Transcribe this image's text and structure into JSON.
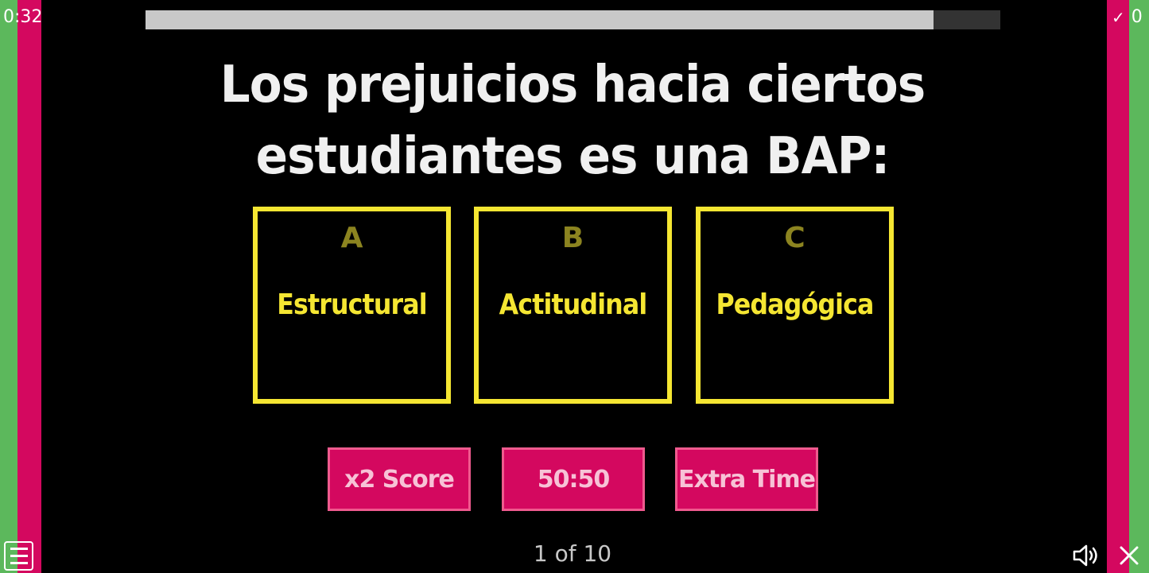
{
  "timer": "0:32",
  "score": {
    "icon": "check-icon",
    "value": "0"
  },
  "progress": {
    "fraction": 0.922
  },
  "question": "Los prejuicios hacia ciertos estudiantes es una BAP:",
  "answers": [
    {
      "letter": "A",
      "text": "Estructural"
    },
    {
      "letter": "B",
      "text": "Actitudinal"
    },
    {
      "letter": "C",
      "text": "Pedagógica"
    }
  ],
  "powerups": [
    {
      "label": "x2 Score"
    },
    {
      "label": "50:50"
    },
    {
      "label": "Extra Time"
    }
  ],
  "pager": "1 of 10",
  "icons": {
    "menu": "menu-icon",
    "sound": "speaker-icon",
    "close": "close-icon"
  },
  "colors": {
    "green": "#5cb85c",
    "pink": "#d4085f",
    "yellow": "#f5e632",
    "background": "#000000"
  }
}
